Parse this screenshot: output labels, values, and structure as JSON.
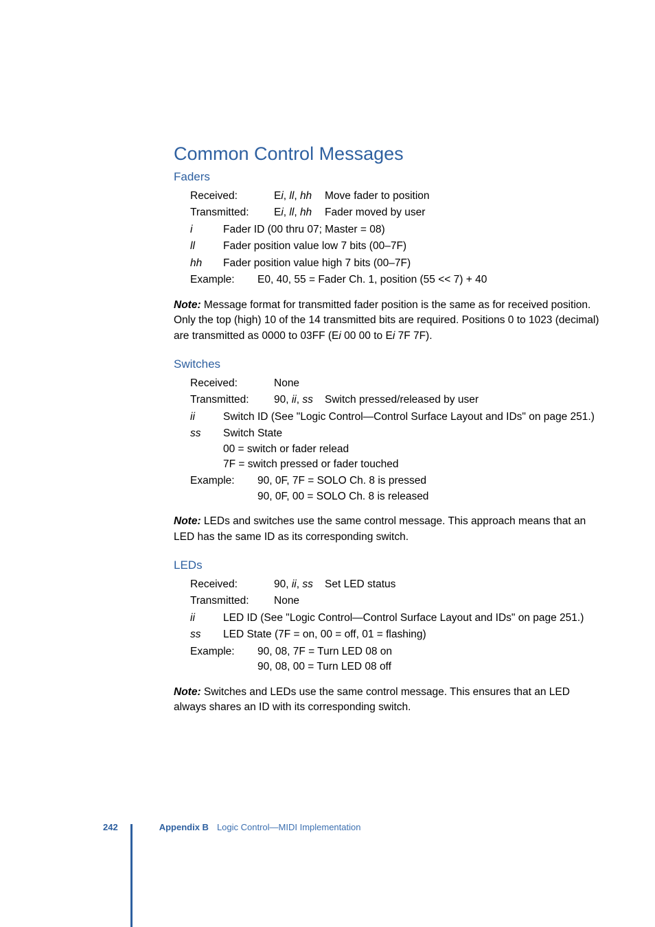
{
  "heading": "Common Control Messages",
  "faders": {
    "title": "Faders",
    "recv_label": "Received:",
    "recv_code": "Ei, ll, hh",
    "recv_desc": "Move fader to position",
    "tx_label": "Transmitted:",
    "tx_code": "Ei, ll, hh",
    "tx_desc": "Fader moved by user",
    "i_key": "i",
    "i_desc": "Fader ID (00 thru 07; Master = 08)",
    "ll_key": "ll",
    "ll_desc": "Fader position value low 7 bits (00–7F)",
    "hh_key": "hh",
    "hh_desc": "Fader position value high 7 bits (00–7F)",
    "ex_label": "Example:",
    "ex_text": "E0, 40, 55 = Fader Ch. 1, position (55 << 7) + 40",
    "note_label": "Note:",
    "note_text": "Message format for transmitted fader position is the same as for received position. Only the top (high) 10 of the 14 transmitted bits are required. Positions 0 to 1023 (decimal) are transmitted as 0000 to 03FF (Ei 00 00 to Ei 7F 7F)."
  },
  "switches": {
    "title": "Switches",
    "recv_label": "Received:",
    "recv_code": "None",
    "tx_label": "Transmitted:",
    "tx_code": "90, ii, ss",
    "tx_desc": "Switch pressed/released by user",
    "ii_key": "ii",
    "ii_desc": "Switch ID (See \"Logic Control—Control Surface Layout and IDs\" on page 251.)",
    "ss_key": "ss",
    "ss_l1": "Switch State",
    "ss_l2": "00 = switch or fader relead",
    "ss_l3": "7F = switch pressed or fader touched",
    "ex_label": "Example:",
    "ex_l1": "90, 0F, 7F = SOLO Ch. 8 is pressed",
    "ex_l2": "90, 0F, 00 = SOLO Ch. 8 is released",
    "note_label": "Note:",
    "note_text": "LEDs and switches use the same control message. This approach means that an LED has the same ID as its corresponding switch."
  },
  "leds": {
    "title": "LEDs",
    "recv_label": "Received:",
    "recv_code": "90, ii, ss",
    "recv_desc": "Set LED status",
    "tx_label": "Transmitted:",
    "tx_code": "None",
    "ii_key": "ii",
    "ii_desc": "LED ID (See \"Logic Control—Control Surface Layout and IDs\" on page 251.)",
    "ss_key": "ss",
    "ss_desc": "LED State (7F = on, 00 = off, 01 = flashing)",
    "ex_label": "Example:",
    "ex_l1": "90, 08, 7F = Turn LED 08 on",
    "ex_l2": "90, 08, 00 = Turn LED 08 off",
    "note_label": "Note:",
    "note_text": "Switches and LEDs use the same control message. This ensures that an LED always shares an ID with its corresponding switch."
  },
  "footer": {
    "page": "242",
    "appendix": "Appendix B",
    "title": "Logic Control—MIDI Implementation"
  }
}
